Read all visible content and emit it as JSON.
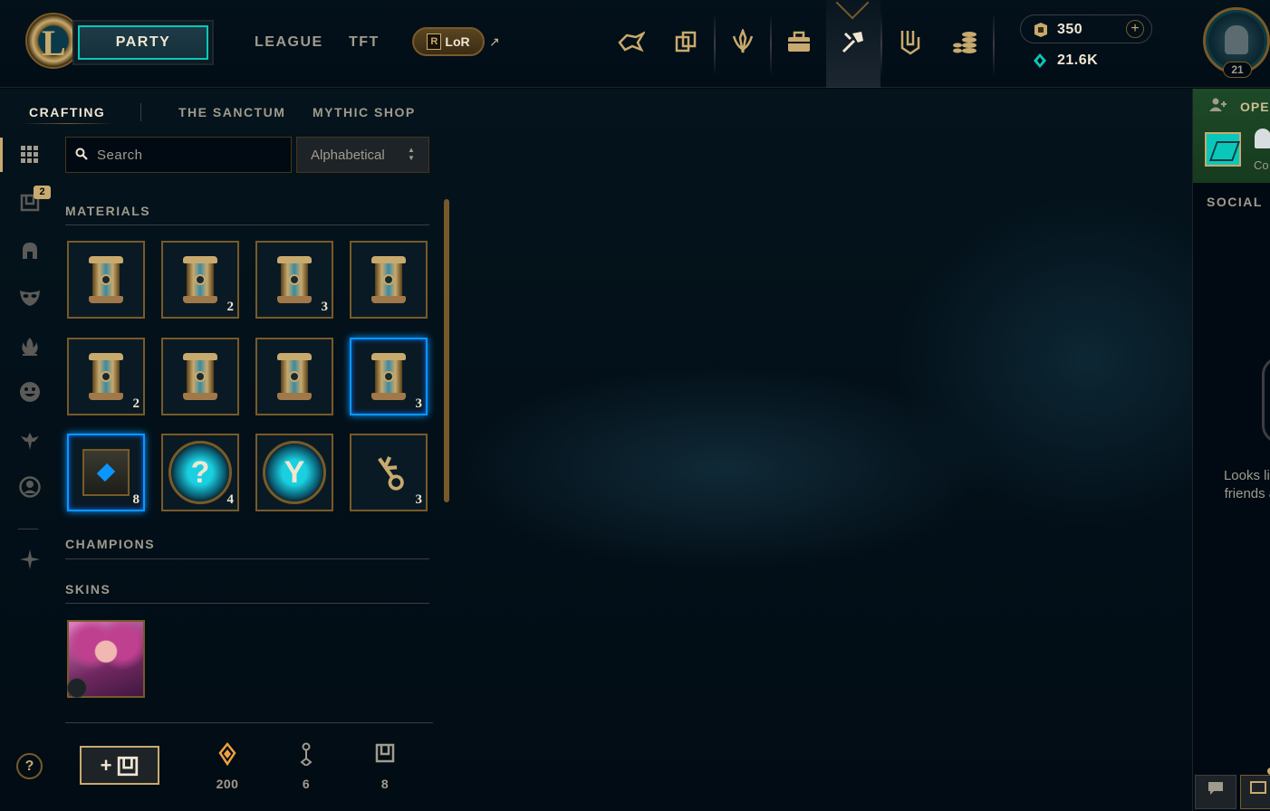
{
  "topnav": {
    "party_label": "PARTY",
    "links": [
      "LEAGUE",
      "TFT"
    ],
    "lor_label": "LoR",
    "lor_letter": "R",
    "external_arrow": "↗",
    "icons": [
      "tft-little-legends-icon",
      "collection-cards-icon",
      "honor-icon",
      "loot-bag-icon",
      "crafting-hammer-icon",
      "clash-shield-icon",
      "store-coins-icon"
    ],
    "active_icon": "crafting-hammer-icon"
  },
  "currency": {
    "rp": "350",
    "add_symbol": "+",
    "blue_essence": "21.6K"
  },
  "profile": {
    "level": "21"
  },
  "subnav": {
    "tabs": [
      "CRAFTING",
      "THE SANCTUM",
      "MYTHIC SHOP"
    ],
    "active": "CRAFTING"
  },
  "sidebar": {
    "icons": [
      "grid-all-icon",
      "chest-icon",
      "champion-helm-icon",
      "skin-mask-icon",
      "ward-flame-icon",
      "emote-face-icon",
      "tft-icon",
      "profile-icon",
      "rune-icon"
    ],
    "chest_badge": "2",
    "help_label": "?"
  },
  "search": {
    "placeholder": "Search",
    "value": ""
  },
  "sort": {
    "selected": "Alphabetical"
  },
  "sections": {
    "materials": "MATERIALS",
    "champions": "CHAMPIONS",
    "skins": "SKINS"
  },
  "materials": [
    {
      "kind": "capsule",
      "count": ""
    },
    {
      "kind": "capsule",
      "count": "2"
    },
    {
      "kind": "capsule",
      "count": "3"
    },
    {
      "kind": "capsule",
      "count": ""
    },
    {
      "kind": "capsule",
      "count": "2"
    },
    {
      "kind": "capsule",
      "count": ""
    },
    {
      "kind": "capsule",
      "count": ""
    },
    {
      "kind": "capsule",
      "count": "3",
      "selected": true
    },
    {
      "kind": "chest",
      "count": "8",
      "selected": true
    },
    {
      "kind": "mystery-orb",
      "count": "4",
      "symbol": "?"
    },
    {
      "kind": "emote-orb",
      "count": "",
      "symbol": "Y"
    },
    {
      "kind": "key",
      "count": "3",
      "symbol": "⚷"
    }
  ],
  "skins": [
    {
      "kind": "skin-shard"
    }
  ],
  "footer": {
    "add_chest_label": "+",
    "orange_essence": "200",
    "keys": "6",
    "chests": "8"
  },
  "social": {
    "open_party_label": "OPEN PARTY",
    "party_member_label": "Co",
    "title": "SOCIAL",
    "empty_text": "Looks like your friends aren't a"
  },
  "colors": {
    "gold": "#c8aa6e",
    "teal": "#0ac8b9",
    "selected_blue": "#0a96ff",
    "background": "#010a13"
  }
}
